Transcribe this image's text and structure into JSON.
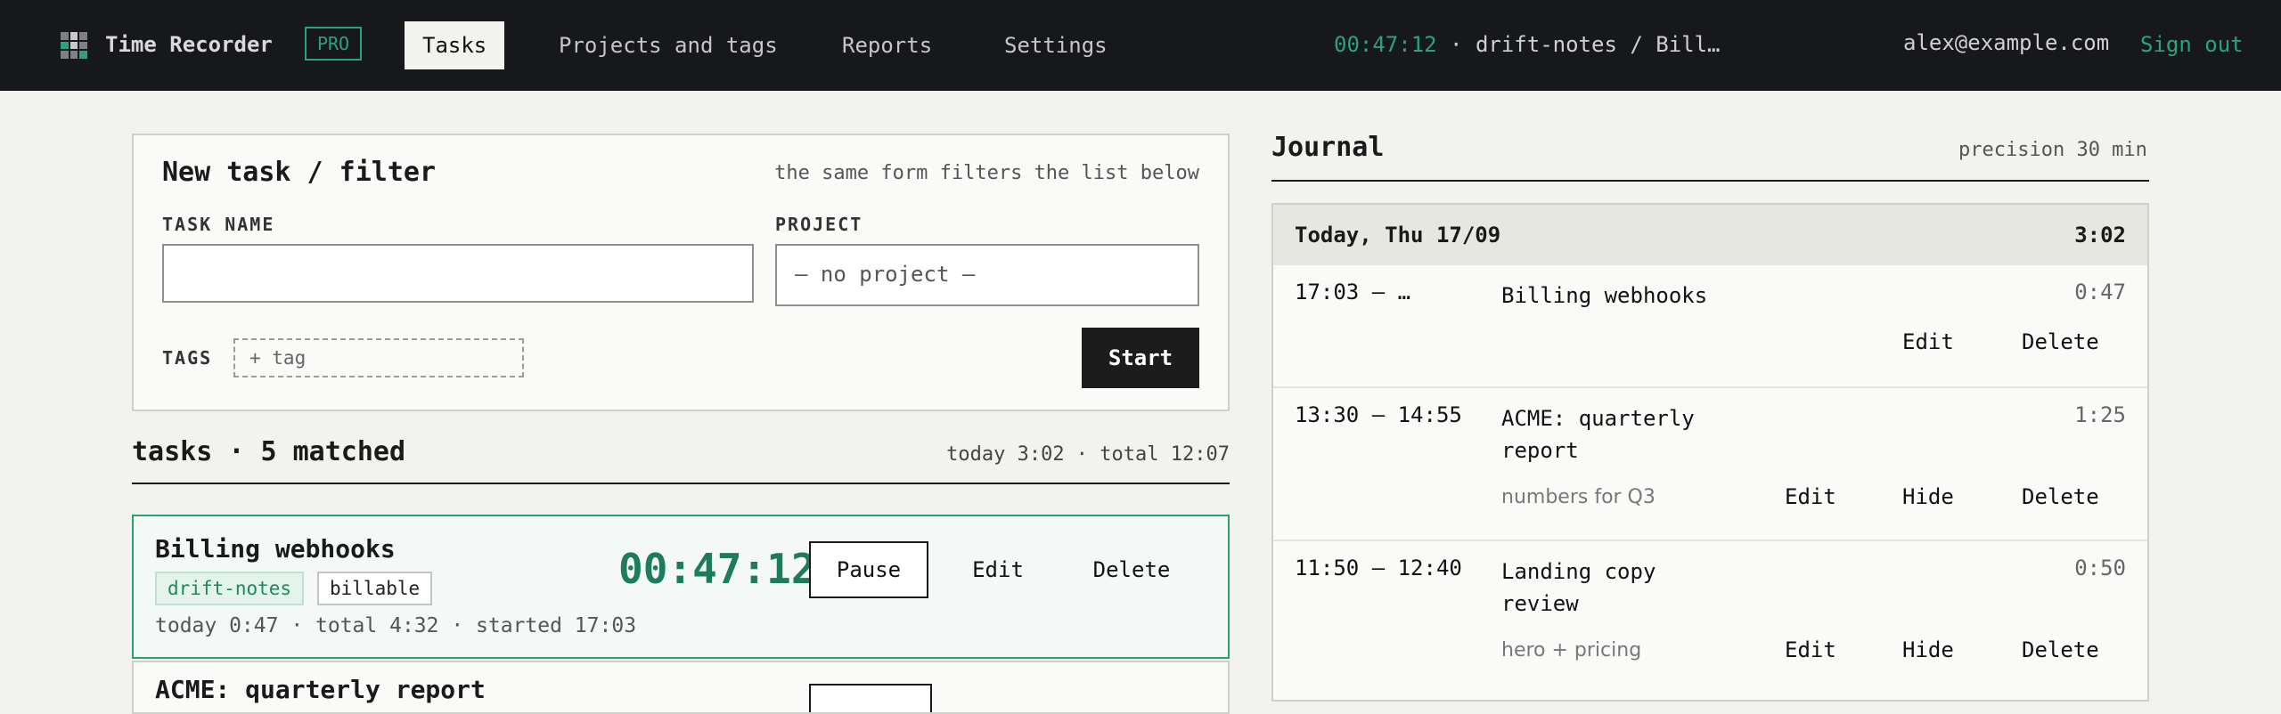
{
  "header": {
    "app_title": "Time Recorder",
    "badge": "PRO",
    "nav": [
      {
        "label": "Tasks",
        "active": true
      },
      {
        "label": "Projects and tags",
        "active": false
      },
      {
        "label": "Reports",
        "active": false
      },
      {
        "label": "Settings",
        "active": false
      }
    ],
    "running_timer": {
      "time": "00:47:12",
      "separator": "·",
      "description": "drift-notes / Bill…"
    },
    "user_email": "alex@example.com",
    "sign_out": "Sign out",
    "accent_color": "#2aa37a"
  },
  "form": {
    "title": "New task / filter",
    "hint": "the same form filters the list below",
    "task_name_label": "TASK NAME",
    "task_name_value": "",
    "project_label": "PROJECT",
    "project_value": "— no project —",
    "tags_label": "TAGS",
    "tag_placeholder": "+ tag",
    "start_label": "Start"
  },
  "tasks": {
    "heading": "tasks · 5 matched",
    "summary": "today 3:02 · total 12:07",
    "items": [
      {
        "name": "Billing webhooks",
        "project": "drift-notes",
        "tags": [
          "billable"
        ],
        "meta": "today 0:47 · total 4:32 · started 17:03",
        "timer": "00:47:12",
        "running": true,
        "actions": [
          "Pause",
          "Edit",
          "Delete"
        ]
      },
      {
        "name": "ACME: quarterly report"
      }
    ]
  },
  "journal": {
    "title": "Journal",
    "precision": "precision 30 min",
    "day": {
      "label": "Today, Thu 17/09",
      "total": "3:02"
    },
    "entries": [
      {
        "time": "17:03 – …",
        "title": "Billing webhooks",
        "duration": "0:47",
        "note": "",
        "actions": [
          "Edit",
          "Delete"
        ]
      },
      {
        "time": "13:30 – 14:55",
        "title": "ACME: quarterly report",
        "duration": "1:25",
        "note": "numbers for Q3",
        "actions": [
          "Edit",
          "Hide",
          "Delete"
        ]
      },
      {
        "time": "11:50 – 12:40",
        "title": "Landing copy review",
        "duration": "0:50",
        "note": "hero + pricing",
        "actions": [
          "Edit",
          "Hide",
          "Delete"
        ]
      }
    ]
  }
}
